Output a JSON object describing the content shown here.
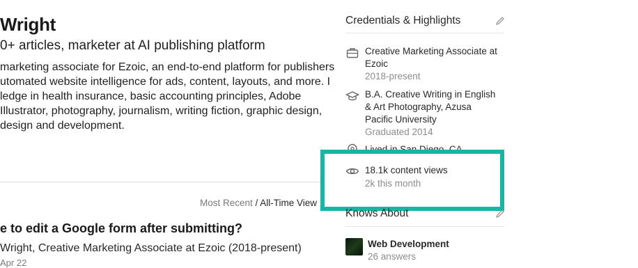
{
  "profile": {
    "name": "Wright",
    "tagline": "0+ articles, marketer at AI publishing platform",
    "bio": [
      "marketing associate for Ezoic, an end-to-end platform for publishers",
      "utomated website intelligence for ads, content, layouts, and more. I",
      "ledge in health insurance, basic accounting principles, Adobe",
      " Illustrator, photography, journalism, writing fiction, graphic design,",
      "design and development."
    ]
  },
  "feed": {
    "sort_recent": "Most Recent",
    "sort_separator": " / ",
    "sort_alltime": "All-Time View",
    "question_title": "e to edit a Google form after submitting?",
    "question_author": " Wright, Creative Marketing Associate at Ezoic (2018-present)",
    "question_date": "Apr 22"
  },
  "sidebar": {
    "credentials_title": "Credentials & Highlights",
    "credentials": [
      {
        "icon": "briefcase-icon",
        "lines": [
          "Creative Marketing Associate at",
          "Ezoic"
        ],
        "sub": "2018-present"
      },
      {
        "icon": "graduation-cap-icon",
        "lines": [
          "B.A. Creative Writing in English",
          "& Art Photography, Azusa",
          "Pacific University"
        ],
        "sub": "Graduated 2014"
      },
      {
        "icon": "location-pin-icon",
        "lines": [
          "Lived in San Diego, CA"
        ],
        "sub": ""
      }
    ],
    "views": {
      "icon": "eye-icon",
      "text": "18.1k content views",
      "sub": "2k this month"
    },
    "knows_about_title": "Knows About",
    "topics": [
      {
        "name": "Web Development",
        "sub": "26 answers"
      }
    ]
  },
  "colors": {
    "highlight_border": "#18b4a5",
    "text_primary": "#282829",
    "text_secondary": "#8c8c8c"
  }
}
